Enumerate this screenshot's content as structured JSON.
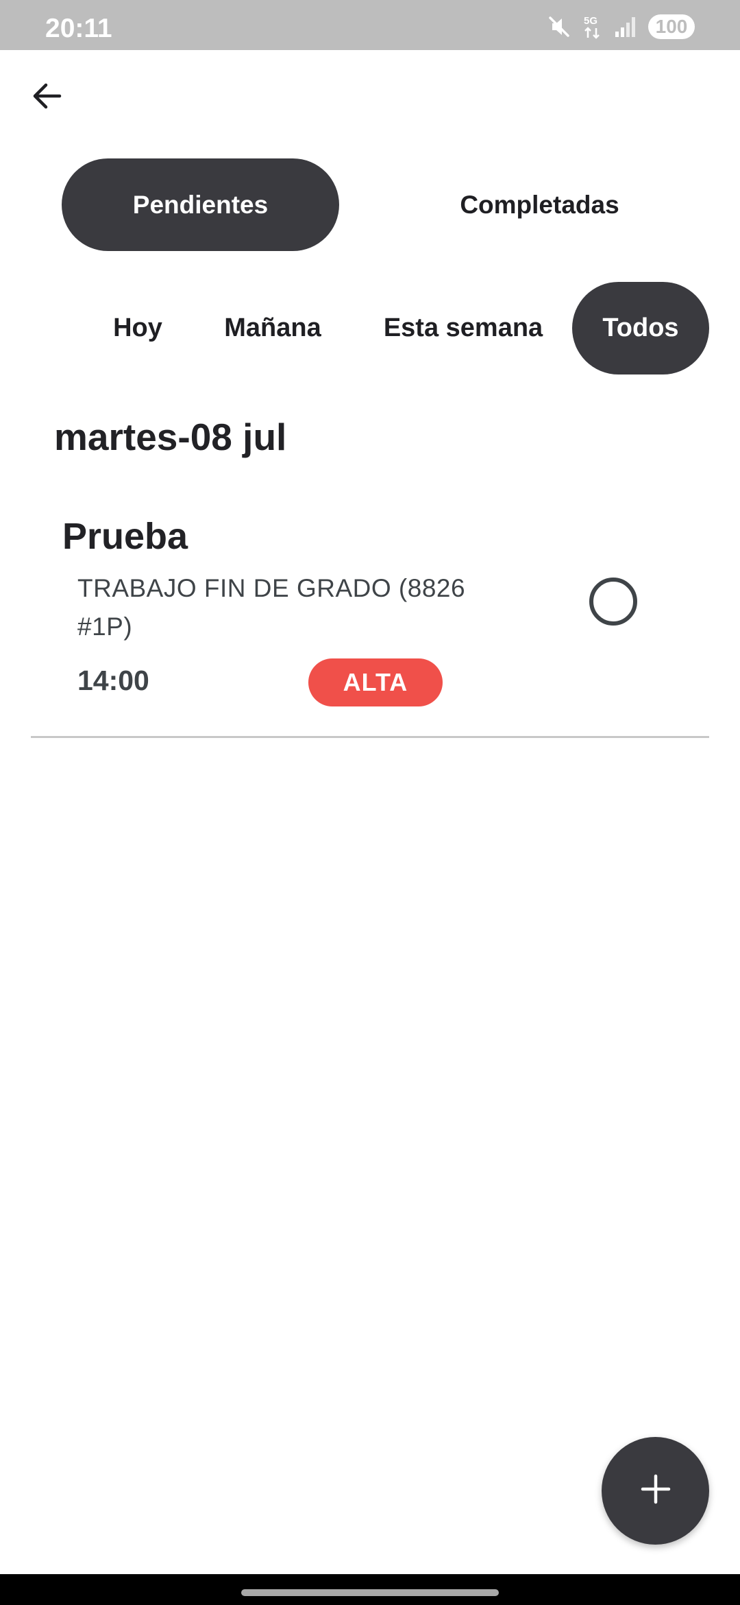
{
  "status_bar": {
    "time": "20:11",
    "network": "5G",
    "battery": "100",
    "icons": [
      "mute-icon",
      "5g-data-icon",
      "signal-icon",
      "battery-icon"
    ]
  },
  "header": {
    "back_icon": "arrow-left-icon"
  },
  "tabs": [
    {
      "label": "Pendientes",
      "selected": true
    },
    {
      "label": "Completadas",
      "selected": false
    }
  ],
  "filters": [
    {
      "label": "Hoy",
      "selected": false
    },
    {
      "label": "Mañana",
      "selected": false
    },
    {
      "label": "Esta semana",
      "selected": false
    },
    {
      "label": "Todos",
      "selected": true
    }
  ],
  "groups": [
    {
      "date": "martes-08 jul",
      "tasks": [
        {
          "title": "Prueba",
          "subject": "TRABAJO FIN DE GRADO (8826 #1P)",
          "time": "14:00",
          "priority": "ALTA",
          "completed": false
        }
      ]
    }
  ],
  "fab": {
    "icon": "plus-icon"
  },
  "colors": {
    "accent_dark": "#3a3a3f",
    "priority_high": "#f0504a",
    "status_bar": "#bdbdbd",
    "background": "#ffffff"
  }
}
